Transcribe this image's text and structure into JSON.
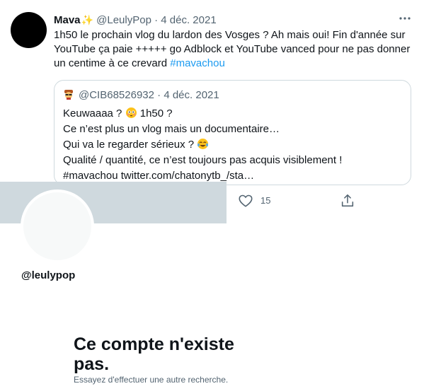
{
  "tweet": {
    "display_name": "Mava",
    "name_emoji": "✨",
    "handle": "@LeulyPop",
    "separator": "·",
    "date": "4 déc. 2021",
    "more_icon": "more-icon",
    "text_main": "1h50 le prochain vlog du lardon des Vosges ? Ah mais oui! Fin d'année sur YouTube ça paie +++++ go Adblock et YouTube vanced pour ne pas donner un centime à ce crevard ",
    "hashtag": "#mavachou"
  },
  "quote": {
    "avatar_icon": "emoji-avatar-icon",
    "handle": "@CIB68526932",
    "separator": "·",
    "date": "4 déc. 2021",
    "line1_pre": "Keuwaaaa ? ",
    "line1_emoji": "flushed-face-emoji",
    "line1_post": " 1h50 ?",
    "line2": "Ce n’est plus un vlog mais un documentaire…",
    "line3_pre": "Qui va le regarder sérieux ? ",
    "line3_emoji": "tears-of-joy-emoji",
    "line4": "Qualité / quantité, ce n’est toujours pas acquis visiblement !",
    "line5": "#mavachou twitter.com/chatonytb_/sta…"
  },
  "actions": {
    "like_icon": "heart-icon",
    "like_count": "15",
    "share_icon": "share-icon"
  },
  "profile": {
    "handle": "@leulypop"
  },
  "error": {
    "title": "Ce compte n'existe pas.",
    "subtitle": "Essayez d'effectuer une autre recherche."
  },
  "colors": {
    "accent": "#1d9bf0",
    "secondary_text": "#536471",
    "border": "#cfd9de"
  }
}
